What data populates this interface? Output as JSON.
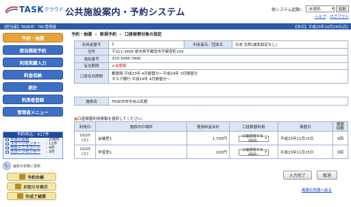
{
  "header": {
    "brand": "TASK",
    "brand_sub": "クラウド",
    "title": "公共施設案内・予約システム",
    "sys_switch_label": "他システム起動：",
    "sys_select_value": "-未選択-",
    "start_button": "起動",
    "link_help": "ヘルプ",
    "link_logout": "ログアウト"
  },
  "topbar": {
    "org": "【担当者】TASK市：TKC管理者",
    "date": "【本日】平成23年10月24日(月)"
  },
  "sidebar": {
    "menu": [
      {
        "label": "予約・抽選",
        "active": true
      },
      {
        "label": "宿泊施設予約",
        "active": false
      },
      {
        "label": "利用実績入力",
        "active": false
      },
      {
        "label": "料金収納",
        "active": false
      },
      {
        "label": "統計",
        "active": false
      },
      {
        "label": "利用者登録",
        "active": false
      },
      {
        "label": "管理者メニュー",
        "active": false
      }
    ],
    "appl_header": "予約申込：417件",
    "appl_rows": [
      {
        "name": "中央公民館",
        "count": "208件"
      },
      {
        "name": "スポーツセンター",
        "count": "11件"
      },
      {
        "name": "市民テニスコート",
        "count": "4件"
      },
      {
        "name": "スポーツセンター",
        "count": "3件"
      }
    ],
    "refresh_label": "最新の状態に更新",
    "sub_buttons": [
      "予約台帳",
      "お知らせ表示",
      "作成了帳票"
    ]
  },
  "main": {
    "breadcrumb": [
      "予約・抽選",
      "新規予約",
      "口座振替対象の指定"
    ],
    "info": {
      "user_no_label": "利用者番号",
      "user_no": "1",
      "user_name_label": "利用者名／団体名",
      "user_name": "日本 太郎(減免設定なし)",
      "address_label": "住所",
      "address": "〒012-3456 栃木県宇都宮市宇都宮町100",
      "phone_label": "電話番号",
      "phone": "333-3456-7890",
      "expiry_label": "有効期限",
      "expiry": "※未期限",
      "account_label": "口座有効期間",
      "account_line1": "郵便局 平成23年 4月振替分～平成24年 3月振替分",
      "account_line2": "タスク銀行 平成24年 4月振替分～"
    },
    "facility": {
      "label": "施設名",
      "value": "TASK市市中央公民館"
    },
    "select_note_mark": "■",
    "select_note": "口座振替利用情報を選択してください。",
    "usage_headers": [
      "利用日",
      "施設内の場所",
      "使用料金合計",
      "口座振替利用",
      "振替日",
      "振替\n回数"
    ],
    "usage_rows": [
      {
        "date": "10/25\n(火)",
        "place": "会議室1",
        "fee": "1,700円",
        "option": "口座振替する(例月)",
        "transfer_date": "平成23年11月15日",
        "times": "0回"
      },
      {
        "date": "10/25\n(火)",
        "place": "学習室1",
        "fee": "200円",
        "option": "口座振替する(例月)",
        "transfer_date": "平成23年11月15日",
        "times": "0回"
      }
    ],
    "btn_complete": "入力完了",
    "btn_cancel": "取消",
    "back_to_top": "画面の先頭へ戻る"
  }
}
